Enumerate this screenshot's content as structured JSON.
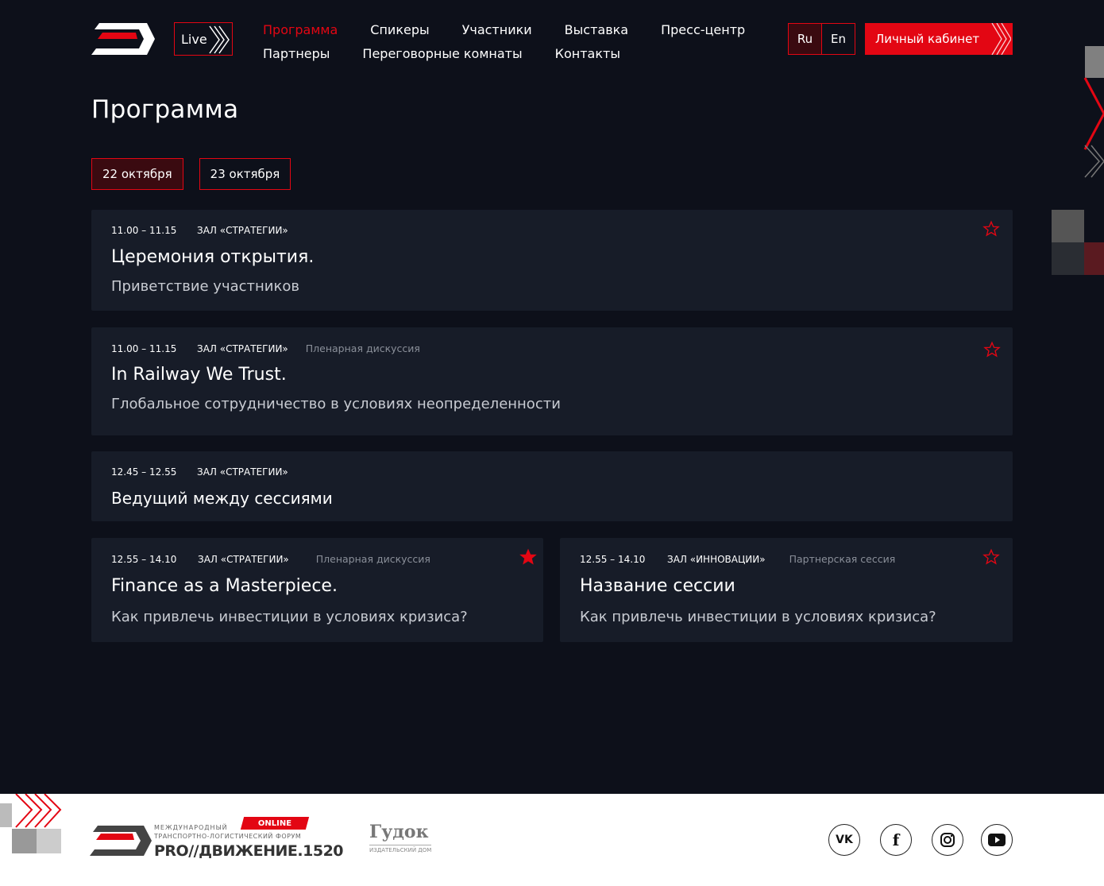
{
  "header": {
    "live_label": "Live",
    "nav": [
      {
        "label": "Программа",
        "active": true
      },
      {
        "label": "Спикеры"
      },
      {
        "label": "Участники"
      },
      {
        "label": "Выставка"
      },
      {
        "label": "Пресс-центр"
      },
      {
        "label": "Партнеры"
      },
      {
        "label": "Переговорные комнаты"
      },
      {
        "label": "Контакты"
      }
    ],
    "lang_ru": "Ru",
    "lang_en": "En",
    "cabinet_label": "Личный кабинет"
  },
  "page_title": "Программа",
  "dates": [
    "22 октября",
    "23 октября"
  ],
  "sessions": [
    {
      "time": "11.00 – 11.15",
      "hall": "ЗАЛ «СТРАТЕГИИ»",
      "type": "",
      "title": "Церемония открытия.",
      "subtitle": "Приветствие участников",
      "favorite": false
    },
    {
      "time": "11.00 – 11.15",
      "hall": "ЗАЛ «СТРАТЕГИИ»",
      "type": "Пленарная дискуссия",
      "title": "In Railway We Trust.",
      "subtitle": "Глобальное сотрудничество в условиях неопределенности",
      "favorite": false
    },
    {
      "time": "12.45 – 12.55",
      "hall": "ЗАЛ «СТРАТЕГИИ»",
      "type": "",
      "title": "Ведущий между сессиями",
      "subtitle": ""
    },
    {
      "time": "12.55 – 14.10",
      "hall": "ЗАЛ «СТРАТЕГИИ»",
      "type": "Пленарная дискуссия",
      "title": "Finance as a Masterpiece.",
      "subtitle": "Как привлечь инвестиции в условиях кризиса?",
      "favorite": true
    },
    {
      "time": "12.55 – 14.10",
      "hall": "ЗАЛ «ИННОВАЦИИ»",
      "type": "Партнерская сессия",
      "title": "Название сессии",
      "subtitle": "Как привлечь инвестиции в условиях кризиса?",
      "favorite": false
    }
  ],
  "footer": {
    "forum_line1": "МЕЖДУНАРОДНЫЙ",
    "forum_line2": "ТРАНСПОРТНО-ЛОГИСТИЧЕСКИЙ ФОРУМ",
    "forum_badge": "ONLINE",
    "forum_name": "PRO//ДВИЖЕНИЕ.1520",
    "gudok_name": "Гудок",
    "gudok_sub": "ИЗДАТЕЛЬСКИЙ ДОМ",
    "social": [
      "vk-icon",
      "facebook-icon",
      "instagram-icon",
      "youtube-icon"
    ]
  },
  "colors": {
    "accent": "#e30613",
    "bg": "#0d101a",
    "card": "#171c28"
  }
}
